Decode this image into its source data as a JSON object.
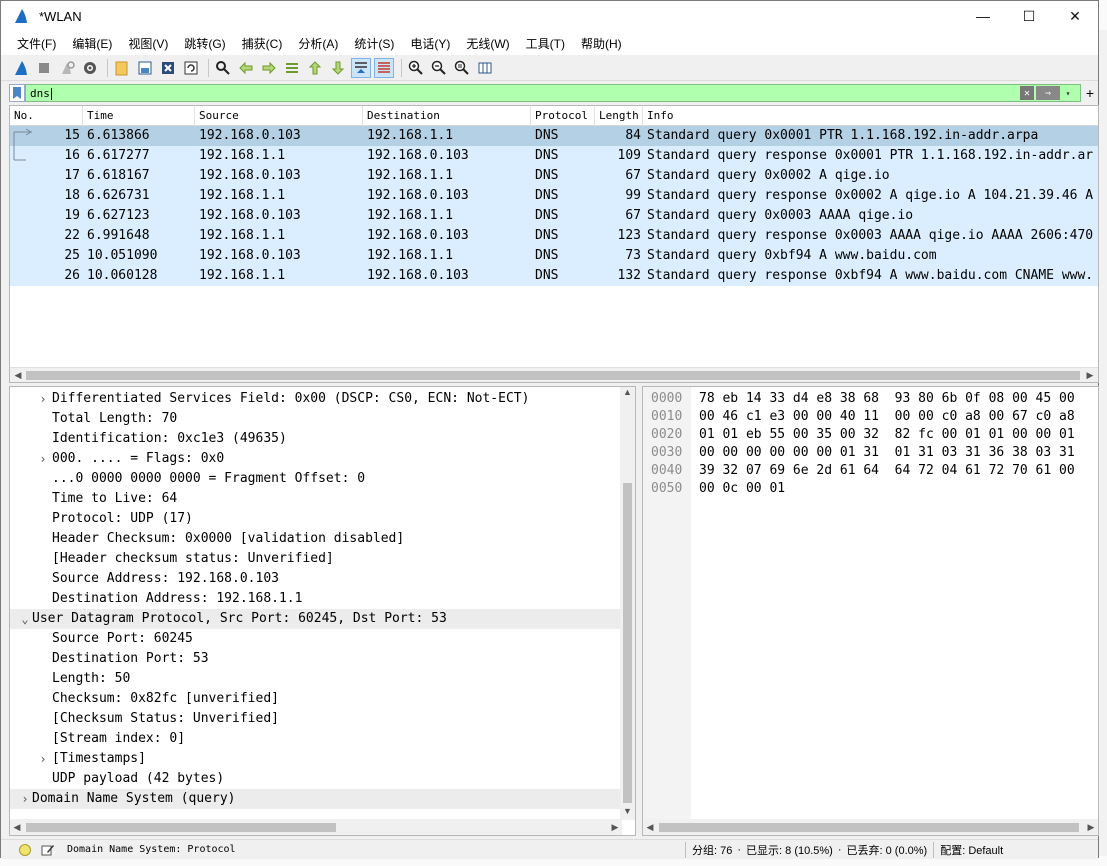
{
  "window": {
    "title": "*WLAN",
    "minimize": "—",
    "maximize": "☐",
    "close": "✕"
  },
  "menu": [
    "文件(F)",
    "编辑(E)",
    "视图(V)",
    "跳转(G)",
    "捕获(C)",
    "分析(A)",
    "统计(S)",
    "电话(Y)",
    "无线(W)",
    "工具(T)",
    "帮助(H)"
  ],
  "filter": {
    "value": "dns",
    "clear": "✕",
    "apply": "⇒",
    "dropdown": "▾",
    "add": "+"
  },
  "columns": [
    "No.",
    "Time",
    "Source",
    "Destination",
    "Protocol",
    "Length",
    "Info"
  ],
  "packets": [
    {
      "no": "15",
      "time": "6.613866",
      "src": "192.168.0.103",
      "dst": "192.168.1.1",
      "proto": "DNS",
      "len": "84",
      "info": "Standard query 0x0001 PTR 1.1.168.192.in-addr.arpa",
      "selected": true
    },
    {
      "no": "16",
      "time": "6.617277",
      "src": "192.168.1.1",
      "dst": "192.168.0.103",
      "proto": "DNS",
      "len": "109",
      "info": "Standard query response 0x0001 PTR 1.1.168.192.in-addr.ar",
      "selected": false
    },
    {
      "no": "17",
      "time": "6.618167",
      "src": "192.168.0.103",
      "dst": "192.168.1.1",
      "proto": "DNS",
      "len": "67",
      "info": "Standard query 0x0002 A qige.io",
      "selected": false
    },
    {
      "no": "18",
      "time": "6.626731",
      "src": "192.168.1.1",
      "dst": "192.168.0.103",
      "proto": "DNS",
      "len": "99",
      "info": "Standard query response 0x0002 A qige.io A 104.21.39.46 A",
      "selected": false
    },
    {
      "no": "19",
      "time": "6.627123",
      "src": "192.168.0.103",
      "dst": "192.168.1.1",
      "proto": "DNS",
      "len": "67",
      "info": "Standard query 0x0003 AAAA qige.io",
      "selected": false
    },
    {
      "no": "22",
      "time": "6.991648",
      "src": "192.168.1.1",
      "dst": "192.168.0.103",
      "proto": "DNS",
      "len": "123",
      "info": "Standard query response 0x0003 AAAA qige.io AAAA 2606:470",
      "selected": false
    },
    {
      "no": "25",
      "time": "10.051090",
      "src": "192.168.0.103",
      "dst": "192.168.1.1",
      "proto": "DNS",
      "len": "73",
      "info": "Standard query 0xbf94 A www.baidu.com",
      "selected": false
    },
    {
      "no": "26",
      "time": "10.060128",
      "src": "192.168.1.1",
      "dst": "192.168.0.103",
      "proto": "DNS",
      "len": "132",
      "info": "Standard query response 0xbf94 A www.baidu.com CNAME www.",
      "selected": false
    }
  ],
  "details": [
    {
      "text": "Differentiated Services Field: 0x00 (DSCP: CS0, ECN: Not-ECT)",
      "arrow": "›",
      "level": 1
    },
    {
      "text": "Total Length: 70",
      "arrow": "",
      "level": 2
    },
    {
      "text": "Identification: 0xc1e3 (49635)",
      "arrow": "",
      "level": 2
    },
    {
      "text": "000. .... = Flags: 0x0",
      "arrow": "›",
      "level": 1
    },
    {
      "text": "...0 0000 0000 0000 = Fragment Offset: 0",
      "arrow": "",
      "level": 2
    },
    {
      "text": "Time to Live: 64",
      "arrow": "",
      "level": 2
    },
    {
      "text": "Protocol: UDP (17)",
      "arrow": "",
      "level": 2
    },
    {
      "text": "Header Checksum: 0x0000 [validation disabled]",
      "arrow": "",
      "level": 2
    },
    {
      "text": "[Header checksum status: Unverified]",
      "arrow": "",
      "level": 2
    },
    {
      "text": "Source Address: 192.168.0.103",
      "arrow": "",
      "level": 2
    },
    {
      "text": "Destination Address: 192.168.1.1",
      "arrow": "",
      "level": 2
    },
    {
      "text": "User Datagram Protocol, Src Port: 60245, Dst Port: 53",
      "arrow": "⌄",
      "level": 0,
      "highlight": true
    },
    {
      "text": "Source Port: 60245",
      "arrow": "",
      "level": 2
    },
    {
      "text": "Destination Port: 53",
      "arrow": "",
      "level": 2
    },
    {
      "text": "Length: 50",
      "arrow": "",
      "level": 2
    },
    {
      "text": "Checksum: 0x82fc [unverified]",
      "arrow": "",
      "level": 2
    },
    {
      "text": "[Checksum Status: Unverified]",
      "arrow": "",
      "level": 2
    },
    {
      "text": "[Stream index: 0]",
      "arrow": "",
      "level": 2
    },
    {
      "text": "[Timestamps]",
      "arrow": "›",
      "level": 1
    },
    {
      "text": "UDP payload (42 bytes)",
      "arrow": "",
      "level": 2
    },
    {
      "text": "Domain Name System (query)",
      "arrow": "›",
      "level": 0,
      "highlight": true
    }
  ],
  "hex": [
    {
      "offset": "0000",
      "bytes": "78 eb 14 33 d4 e8 38 68  93 80 6b 0f 08 00 45 00"
    },
    {
      "offset": "0010",
      "bytes": "00 46 c1 e3 00 00 40 11  00 00 c0 a8 00 67 c0 a8"
    },
    {
      "offset": "0020",
      "bytes": "01 01 eb 55 00 35 00 32  82 fc 00 01 01 00 00 01"
    },
    {
      "offset": "0030",
      "bytes": "00 00 00 00 00 00 01 31  01 31 03 31 36 38 03 31"
    },
    {
      "offset": "0040",
      "bytes": "39 32 07 69 6e 2d 61 64  64 72 04 61 72 70 61 00"
    },
    {
      "offset": "0050",
      "bytes": "00 0c 00 01"
    }
  ],
  "status": {
    "left": "Domain Name System: Protocol",
    "packets": "分组: 76",
    "displayed": "已显示: 8 (10.5%)",
    "dropped": "已丢弃: 0 (0.0%)",
    "profile": "配置: Default"
  },
  "colors": {
    "row": "#daeeff",
    "row_selected": "#b4d0e4",
    "filter_valid": "#afffaf"
  }
}
